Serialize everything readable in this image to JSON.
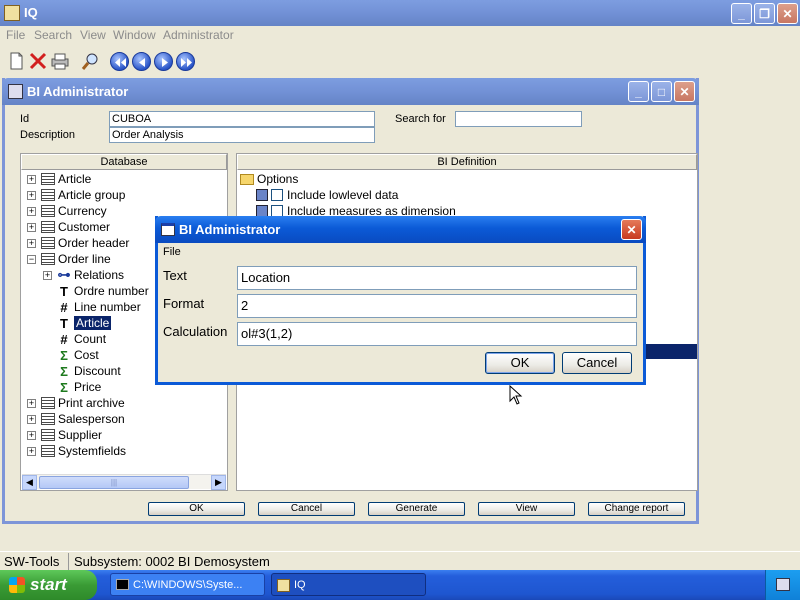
{
  "app": {
    "title": "IQ"
  },
  "menubar": [
    "File",
    "Search",
    "View",
    "Window",
    "Administrator"
  ],
  "toolbar": {
    "icons": [
      "new-document-icon",
      "delete-icon",
      "print-icon",
      "search-icon",
      "first-record-icon",
      "previous-record-icon",
      "next-record-icon",
      "last-record-icon"
    ]
  },
  "bi_window": {
    "title": "BI Administrator",
    "id_label": "Id",
    "id_value": "CUBOA",
    "description_label": "Description",
    "description_value": "Order Analysis",
    "search_label": "Search for",
    "search_value": "",
    "database_header": "Database",
    "definition_header": "BI Definition",
    "tree": [
      {
        "label": "Article",
        "kind": "table",
        "indent": 0,
        "expander": "+"
      },
      {
        "label": "Article group",
        "kind": "table",
        "indent": 0,
        "expander": "+"
      },
      {
        "label": "Currency",
        "kind": "table",
        "indent": 0,
        "expander": "+"
      },
      {
        "label": "Customer",
        "kind": "table",
        "indent": 0,
        "expander": "+"
      },
      {
        "label": "Order header",
        "kind": "table",
        "indent": 0,
        "expander": "+"
      },
      {
        "label": "Order line",
        "kind": "table",
        "indent": 0,
        "expander": "-"
      },
      {
        "label": "Relations",
        "kind": "relation",
        "indent": 1,
        "expander": "+"
      },
      {
        "label": "Ordre number",
        "kind": "text",
        "indent": 1,
        "expander": ""
      },
      {
        "label": "Line number",
        "kind": "number",
        "indent": 1,
        "expander": ""
      },
      {
        "label": "Article",
        "kind": "text",
        "indent": 1,
        "expander": "",
        "selected": true
      },
      {
        "label": "Count",
        "kind": "number",
        "indent": 1,
        "expander": ""
      },
      {
        "label": "Cost",
        "kind": "sum",
        "indent": 1,
        "expander": ""
      },
      {
        "label": "Discount",
        "kind": "sum",
        "indent": 1,
        "expander": ""
      },
      {
        "label": "Price",
        "kind": "sum",
        "indent": 1,
        "expander": ""
      },
      {
        "label": "Print archive",
        "kind": "table",
        "indent": 0,
        "expander": "+"
      },
      {
        "label": "Salesperson",
        "kind": "table",
        "indent": 0,
        "expander": "+"
      },
      {
        "label": "Supplier",
        "kind": "table",
        "indent": 0,
        "expander": "+"
      },
      {
        "label": "Systemfields",
        "kind": "table",
        "indent": 0,
        "expander": "+"
      }
    ],
    "definition": {
      "options_label": "Options",
      "opt1": "Include lowlevel data",
      "opt2": "Include measures as dimension"
    },
    "buttons": {
      "ok": "OK",
      "cancel": "Cancel",
      "generate": "Generate",
      "view": "View",
      "change_report": "Change report"
    }
  },
  "dialog": {
    "title": "BI Administrator",
    "menu_file": "File",
    "text_label": "Text",
    "text_value": "Location",
    "format_label": "Format",
    "format_value": "2",
    "calculation_label": "Calculation",
    "calculation_value": "ol#3(1,2)",
    "ok_label": "OK",
    "cancel_label": "Cancel"
  },
  "statusbar": {
    "left": "SW-Tools",
    "right": "Subsystem: 0002 BI Demosystem"
  },
  "taskbar": {
    "start_label": "start",
    "tasks": [
      "C:\\WINDOWS\\Syste...",
      "IQ"
    ]
  },
  "colors": {
    "selection": "#0a246a",
    "titlebar": "#0450c6",
    "taskbar": "#245edb",
    "start": "#3a9b35"
  }
}
